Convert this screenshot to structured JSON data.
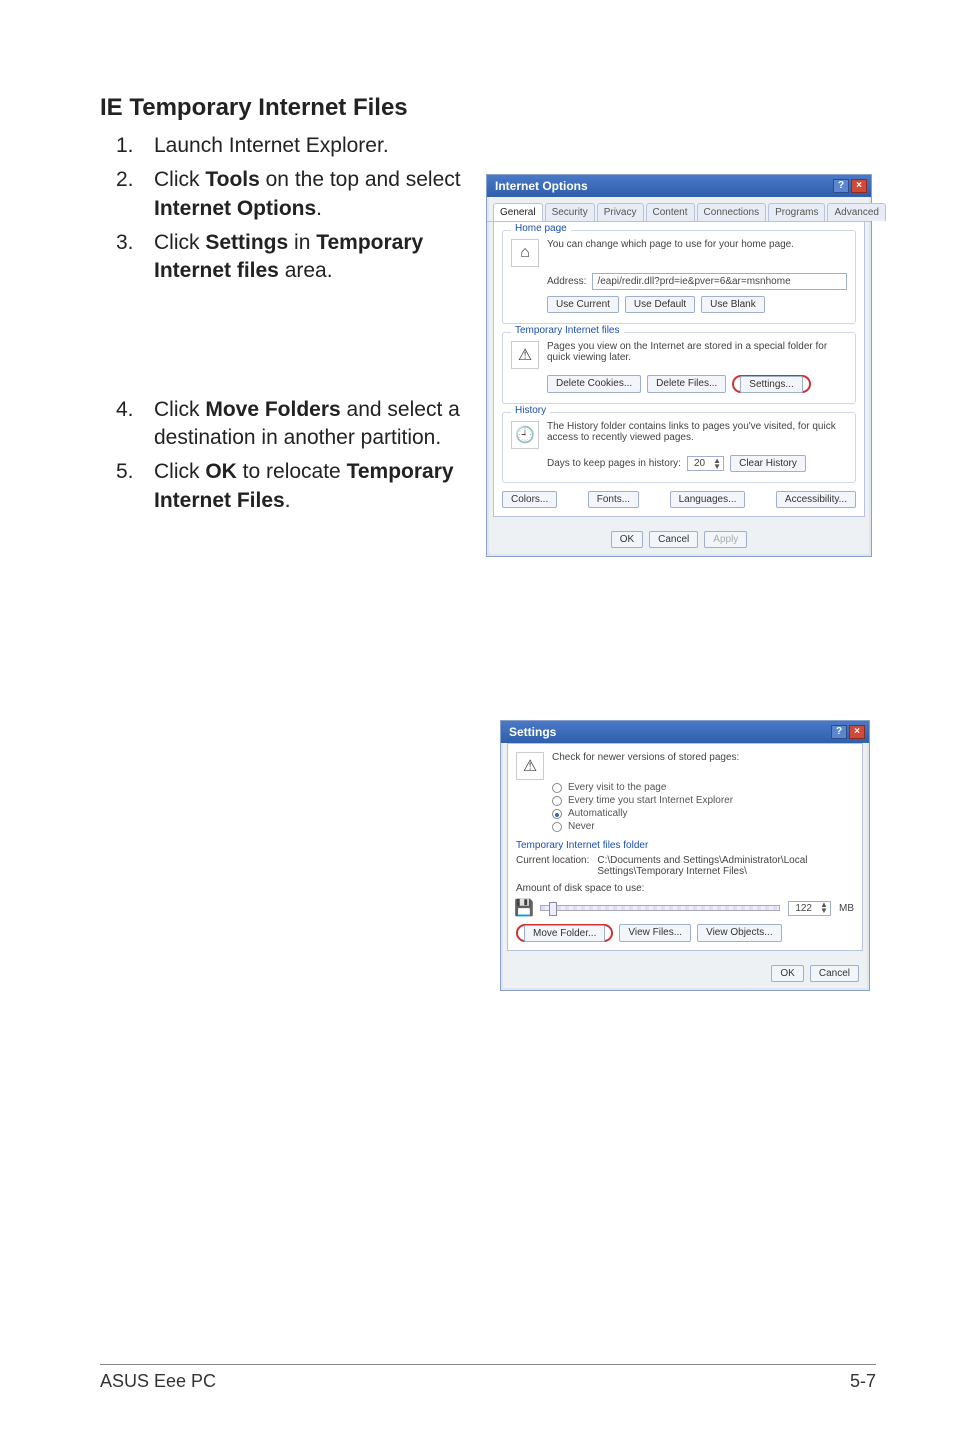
{
  "section_title": "IE Temporary Internet Files",
  "steps_a": [
    {
      "n": "1.",
      "text": "Launch Internet Explorer."
    },
    {
      "n": "2.",
      "text_pre": "Click ",
      "b1": "Tools",
      "mid1": " on the top and select ",
      "b2": "Internet Options",
      "post": "."
    },
    {
      "n": "3.",
      "text_pre": "Click ",
      "b1": "Settings",
      "mid1": " in ",
      "b2": "Temporary Internet files",
      "post": " area."
    }
  ],
  "steps_b": [
    {
      "n": "4.",
      "text_pre": "Click ",
      "b1": "Move Folders",
      "mid1": " and select a destination in another partition.",
      "b2": "",
      "post": ""
    },
    {
      "n": "5.",
      "text_pre": "Click ",
      "b1": "OK",
      "mid1": " to relocate ",
      "b2": "Temporary Internet Files",
      "post": "."
    }
  ],
  "dialog1": {
    "title": "Internet Options",
    "tabs": [
      "General",
      "Security",
      "Privacy",
      "Content",
      "Connections",
      "Programs",
      "Advanced"
    ],
    "home": {
      "title": "Home page",
      "desc": "You can change which page to use for your home page.",
      "addr_label": "Address:",
      "addr_value": "/eapi/redir.dll?prd=ie&pver=6&ar=msnhome",
      "btns": [
        "Use Current",
        "Use Default",
        "Use Blank"
      ]
    },
    "temp": {
      "title": "Temporary Internet files",
      "desc": "Pages you view on the Internet are stored in a special folder for quick viewing later.",
      "btns": [
        "Delete Cookies...",
        "Delete Files..."
      ],
      "settings_btn": "Settings..."
    },
    "hist": {
      "title": "History",
      "desc": "The History folder contains links to pages you've visited, for quick access to recently viewed pages.",
      "days_label": "Days to keep pages in history:",
      "days_value": "20",
      "clear_btn": "Clear History"
    },
    "bottom_btns": [
      "Colors...",
      "Fonts...",
      "Languages...",
      "Accessibility..."
    ],
    "footer_btns": [
      "OK",
      "Cancel",
      "Apply"
    ]
  },
  "dialog2": {
    "title": "Settings",
    "check_label": "Check for newer versions of stored pages:",
    "radios": [
      "Every visit to the page",
      "Every time you start Internet Explorer",
      "Automatically",
      "Never"
    ],
    "selected_radio": 2,
    "folder_section": "Temporary Internet files folder",
    "loc_label": "Current location:",
    "loc_value": "C:\\Documents and Settings\\Administrator\\Local Settings\\Temporary Internet Files\\",
    "amount_label": "Amount of disk space to use:",
    "amount_value": "122",
    "amount_unit": "MB",
    "btns": {
      "move": "Move Folder...",
      "view_files": "View Files...",
      "view_obj": "View Objects..."
    },
    "footer_btns": [
      "OK",
      "Cancel"
    ]
  },
  "footer": {
    "left": "ASUS Eee PC",
    "right": "5-7"
  }
}
